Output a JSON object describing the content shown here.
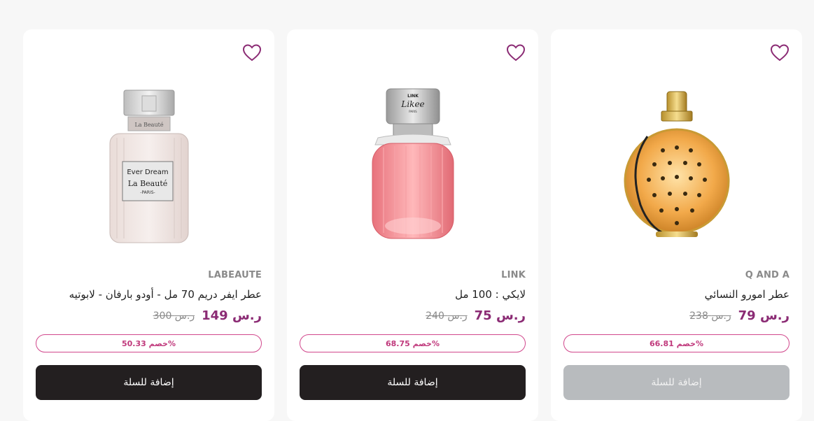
{
  "products": [
    {
      "brand": "LABEAUTE",
      "title": "عطر ايفر دريم 70 مل - أودو بارفان - لابوتيه",
      "price": "149 ر.س",
      "old_price": "300 ر.س",
      "discount": "خصم 50.33%",
      "button": "إضافة للسلة",
      "button_disabled": false,
      "image": "perfume-bottle-ever-dream",
      "label_lines": [
        "Ever Dream",
        "La Beauté",
        "-PARIS-"
      ],
      "cap_text": "La Beauté"
    },
    {
      "brand": "LINK",
      "title": "لايكي : 100 مل",
      "price": "75 ر.س",
      "old_price": "240 ر.س",
      "discount": "خصم 68.75%",
      "button": "إضافة للسلة",
      "button_disabled": false,
      "image": "perfume-bottle-likee",
      "cap_lines": [
        "LINK",
        "Likee",
        "PARIS"
      ]
    },
    {
      "brand": "Q AND A",
      "title": "عطر امورو النسائي",
      "price": "79 ر.س",
      "old_price": "238 ر.س",
      "discount": "خصم 66.81%",
      "button": "إضافة للسلة",
      "button_disabled": true,
      "image": "perfume-bottle-amoro"
    }
  ],
  "colors": {
    "accent": "#8b2b74",
    "badge": "#d1478c",
    "button": "#231f20",
    "button_disabled": "#b8bbbe"
  },
  "icons": {
    "wishlist": "heart-outline-icon"
  }
}
